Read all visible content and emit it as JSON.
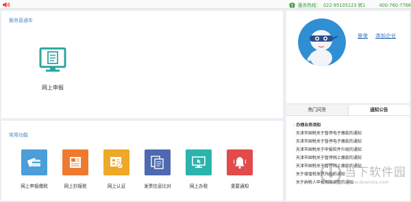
{
  "topbar": {
    "hotline_label": "服务热线：",
    "phone_1": "022-95105123 转1",
    "phone_2": "400-760-7766转1"
  },
  "service": {
    "title": "服务直通车",
    "online_declare": "网上申报"
  },
  "common": {
    "title": "常用功能",
    "items": [
      {
        "label": "网上申报缴税",
        "color": "#4a9fd8",
        "icon": "taxpay-icon"
      },
      {
        "label": "网上抄报税",
        "color": "#ef7a2f",
        "icon": "copy-report-icon"
      },
      {
        "label": "网上认证",
        "color": "#f0a829",
        "icon": "certify-icon"
      },
      {
        "label": "发票信息比对",
        "color": "#4e69b1",
        "icon": "invoice-compare-icon"
      },
      {
        "label": "网上办税",
        "color": "#2bb3ad",
        "icon": "online-tax-icon"
      },
      {
        "label": "重要通知",
        "color": "#e14b4b",
        "icon": "bell-icon"
      }
    ]
  },
  "user": {
    "login": "登录",
    "add_company": "添加企业"
  },
  "notice": {
    "tabs": [
      {
        "label": "热门问答"
      },
      {
        "label": "通知公告"
      }
    ],
    "items": [
      "办理业务须知",
      "天津市国税关于暂停电子缴款的通知",
      "天津市国税关于暂停电子缴款的通知",
      "天津市国税关于申报软件升级的通知",
      "天津市国税关于暂停网上缴款的通知",
      "天津市国税关于暂停网上缴款的通知",
      "关于增值税发票升级的通知",
      "关于纳税人申报期限调整的通知"
    ]
  },
  "watermark": {
    "text": "当下软件园",
    "url": "www.downxia.com"
  }
}
